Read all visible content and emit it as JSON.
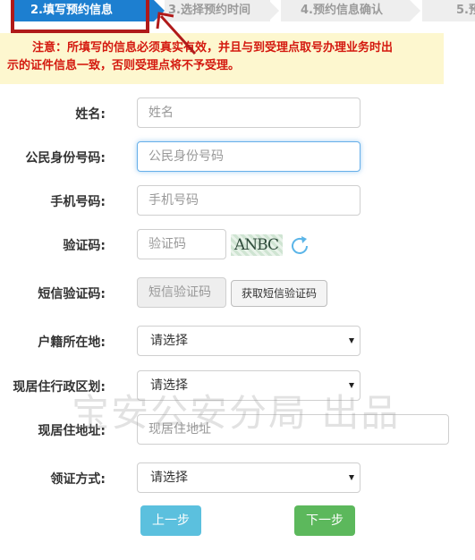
{
  "steps": [
    {
      "label": "2.填写预约信息",
      "active": true
    },
    {
      "label": "3.选择预约时间",
      "active": false
    },
    {
      "label": "4.预约信息确认",
      "active": false
    },
    {
      "label": "5.预",
      "active": false
    }
  ],
  "notice": {
    "line1": "注意：所填写的信息必须真实有效，并且与到受理点取号办理业务时出",
    "line2": "示的证件信息一致，否则受理点将不予受理。"
  },
  "form": {
    "name": {
      "label": "姓名:",
      "placeholder": "姓名"
    },
    "id_number": {
      "label": "公民身份号码:",
      "placeholder": "公民身份号码"
    },
    "phone": {
      "label": "手机号码:",
      "placeholder": "手机号码"
    },
    "captcha": {
      "label": "验证码:",
      "placeholder": "验证码",
      "image_text": "ANBC"
    },
    "sms_code": {
      "label": "短信验证码:",
      "placeholder": "短信验证码",
      "button": "获取短信验证码"
    },
    "household": {
      "label": "户籍所在地:",
      "selected": "请选择"
    },
    "district": {
      "label": "现居住行政区划:",
      "selected": "请选择"
    },
    "address": {
      "label": "现居住地址:",
      "placeholder": "现居住地址"
    },
    "pickup": {
      "label": "领证方式:",
      "selected": "请选择"
    }
  },
  "buttons": {
    "prev": "上一步",
    "next": "下一步"
  },
  "watermark": "宝安公安分局 出品",
  "colors": {
    "active_step": "#1d7fd0",
    "notice_text": "#d4190f",
    "notice_bg": "#fdf7cf",
    "prev_btn": "#5bc0de",
    "next_btn": "#5cb85c",
    "annotation": "#b01a1a"
  }
}
